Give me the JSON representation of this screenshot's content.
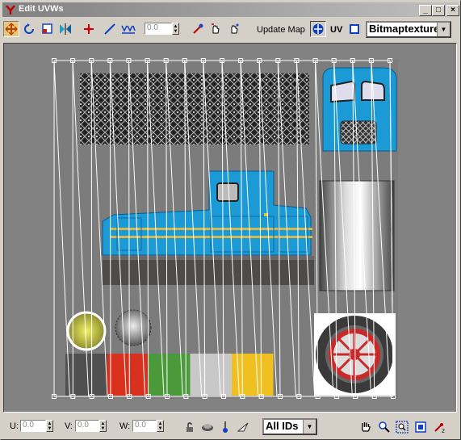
{
  "window": {
    "title": "Edit UVWs",
    "minimize": "_",
    "maximize": "□",
    "close": "×"
  },
  "toolbar": {
    "spinner_value": "0.0",
    "update_map": "Update Map",
    "uv_label": "UV",
    "map_select": "Bitmaptexture",
    "icons": [
      "move-icon",
      "rotate-icon",
      "scale-icon",
      "mirror-icon",
      "add-vertex-icon",
      "line-icon",
      "weld-icon",
      "pick-icon",
      "hand-pick-icon",
      "target-icon",
      "checker-icon",
      "square-icon"
    ]
  },
  "bottombar": {
    "u_label": "U:",
    "u_value": "0.0",
    "v_label": "V:",
    "v_value": "0.0",
    "w_label": "W:",
    "w_value": "0.0",
    "id_select": "All IDs",
    "icons": [
      "lock-icon",
      "hide-icon",
      "freeze-icon",
      "filter-icon",
      "pan-hand-icon",
      "zoom-icon",
      "zoom-region-icon",
      "zoom-extents-icon",
      "snap-icon"
    ]
  },
  "colors": {
    "accent_blue": "#1b9ad6",
    "red": "#d8321e",
    "green": "#4a9a3c",
    "light_gray": "#c8c8c8",
    "yellow": "#f0c020",
    "dark_gray": "#505050",
    "viewport_bg": "#828282",
    "active_tool": "#e7c879"
  },
  "swatches": [
    "#505050",
    "#d8321e",
    "#4a9a3c",
    "#c8c8c8",
    "#f0c020"
  ]
}
